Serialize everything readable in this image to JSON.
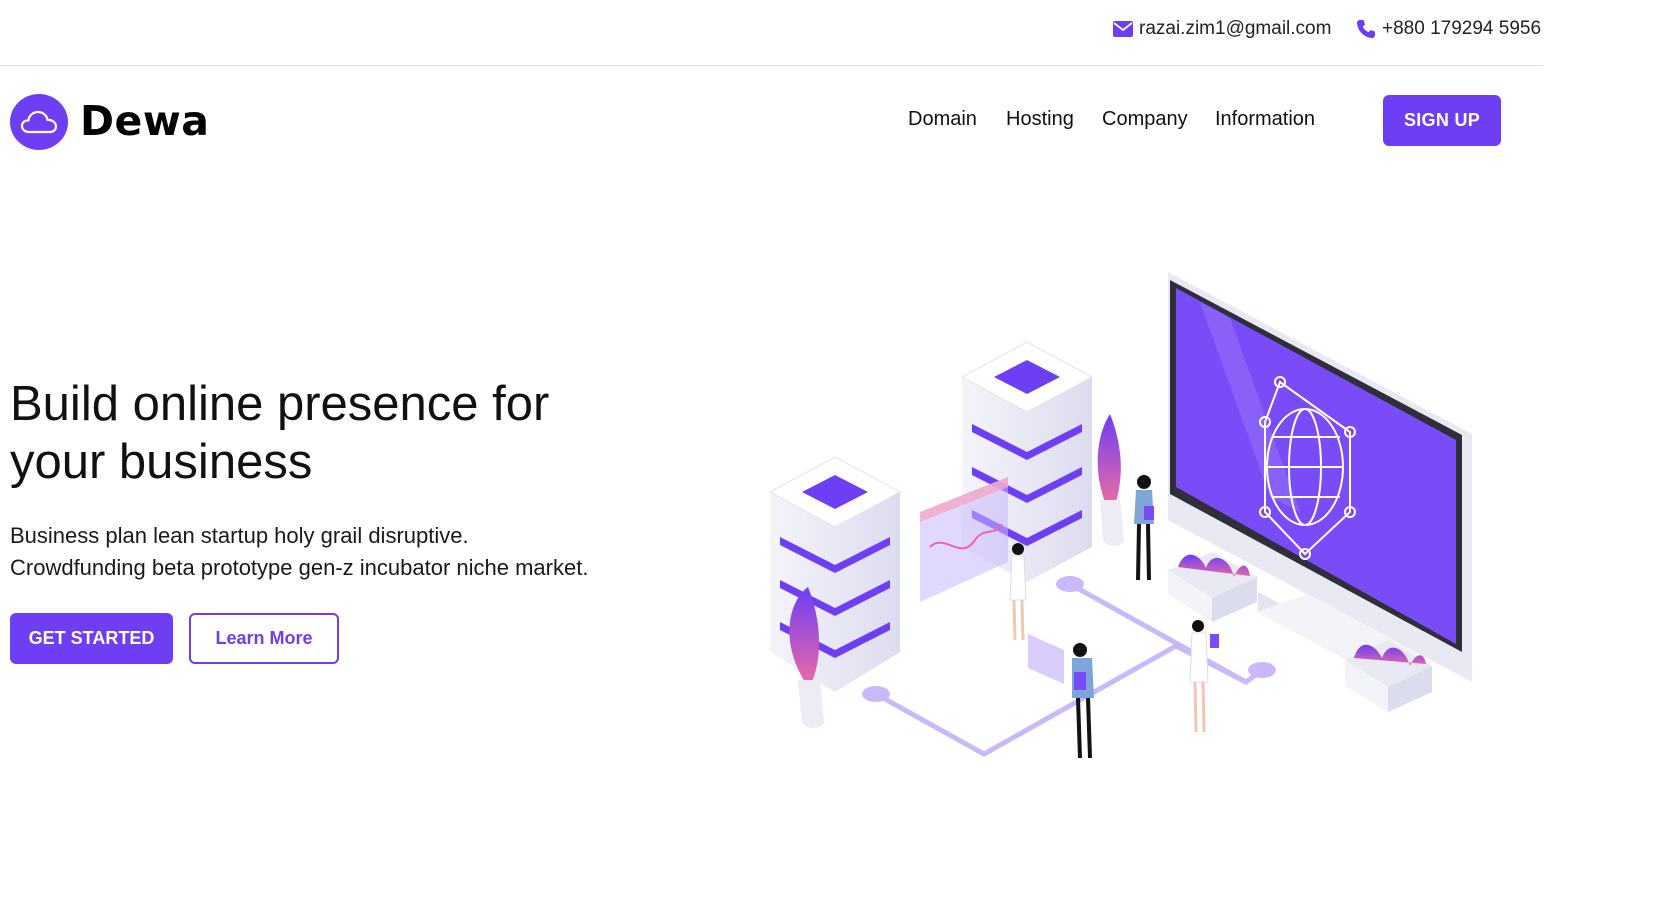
{
  "topbar": {
    "email": "razai.zim1@gmail.com",
    "phone": "+880 179294 5956"
  },
  "brand": {
    "name": "Dewa"
  },
  "nav": {
    "items": [
      "Domain",
      "Hosting",
      "Company",
      "Information"
    ],
    "signup_label": "SIGN UP"
  },
  "hero": {
    "title": "Build online presence for your business",
    "subtitle_line1": "Business plan lean startup holy grail disruptive.",
    "subtitle_line2": "Crowdfunding beta prototype gen-z incubator niche market.",
    "primary_label": "GET STARTED",
    "secondary_label": "Learn More"
  },
  "colors": {
    "accent": "#6e3ef5",
    "accent_light": "#c9b8fb",
    "text": "#111111"
  },
  "icons": {
    "email": "envelope-icon",
    "phone": "phone-icon",
    "logo": "cloud-icon"
  }
}
